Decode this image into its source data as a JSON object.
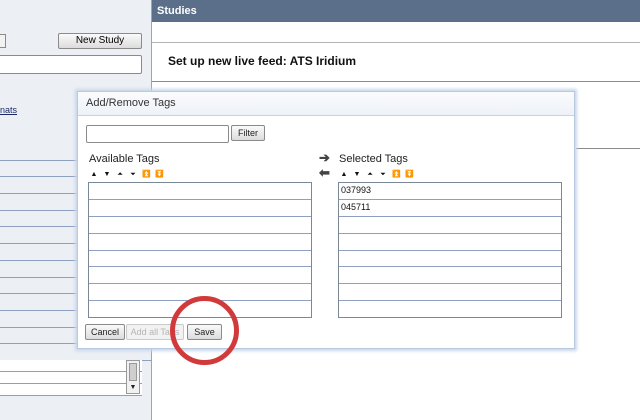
{
  "app": {
    "studies_header": "Studies",
    "new_study_button": "New Study",
    "left_link_fragment": "nats",
    "study_title": "Set up new live feed: ATS Iridium"
  },
  "dialog": {
    "title": "Add/Remove Tags",
    "filter": {
      "value": "",
      "button_label": "Filter"
    },
    "available": {
      "label": "Available Tags",
      "items": [
        "",
        "",
        "",
        "",
        "",
        "",
        "",
        ""
      ]
    },
    "selected": {
      "label": "Selected Tags",
      "items": [
        "037993",
        "045711",
        "",
        "",
        "",
        "",
        "",
        ""
      ]
    },
    "sort_icons": [
      "▲",
      "▼",
      "⏶",
      "⏷",
      "⏫",
      "⏬"
    ],
    "buttons": {
      "cancel": "Cancel",
      "add_all": "Add all Tags",
      "save": "Save"
    }
  },
  "annotation": {
    "color": "#d13a3a",
    "target": "save-button"
  }
}
